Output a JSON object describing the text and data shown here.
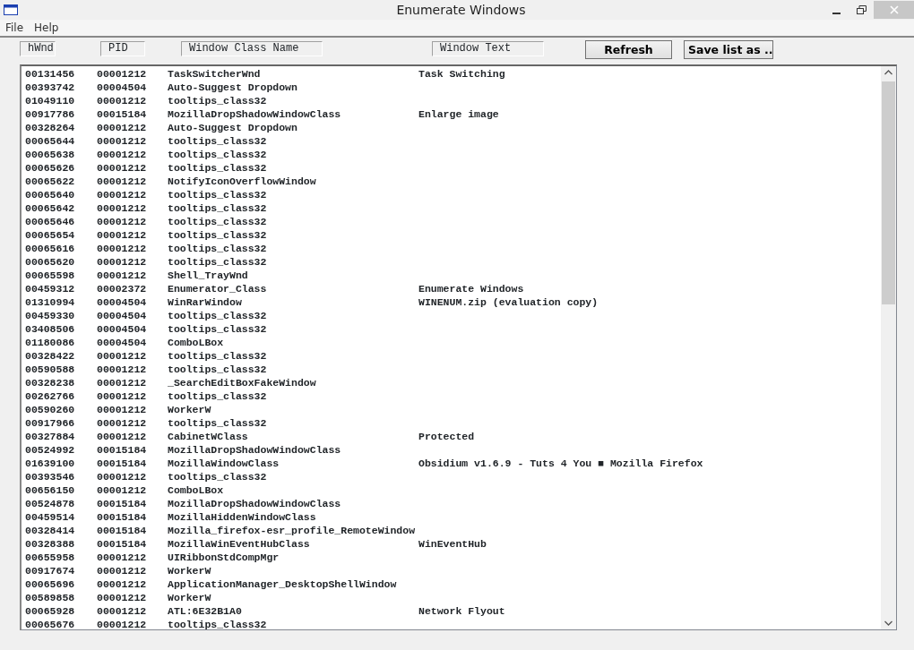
{
  "window": {
    "title": "Enumerate Windows"
  },
  "menu": [
    "File",
    "Help"
  ],
  "headers": [
    "hWnd",
    "PID",
    "Window Class Name",
    "Window Text"
  ],
  "buttons": [
    "Refresh",
    "Save list as .."
  ],
  "rows": [
    {
      "hwnd": "00131456",
      "pid": "00001212",
      "class_name": "TaskSwitcherWnd",
      "text": "Task Switching"
    },
    {
      "hwnd": "00393742",
      "pid": "00004504",
      "class_name": "Auto-Suggest Dropdown"
    },
    {
      "hwnd": "01049110",
      "pid": "00001212",
      "class_name": "tooltips_class32"
    },
    {
      "hwnd": "00917786",
      "pid": "00015184",
      "class_name": "MozillaDropShadowWindowClass",
      "text": "Enlarge image"
    },
    {
      "hwnd": "00328264",
      "pid": "00001212",
      "class_name": "Auto-Suggest Dropdown"
    },
    {
      "hwnd": "00065644",
      "pid": "00001212",
      "class_name": "tooltips_class32"
    },
    {
      "hwnd": "00065638",
      "pid": "00001212",
      "class_name": "tooltips_class32"
    },
    {
      "hwnd": "00065626",
      "pid": "00001212",
      "class_name": "tooltips_class32"
    },
    {
      "hwnd": "00065622",
      "pid": "00001212",
      "class_name": "NotifyIconOverflowWindow"
    },
    {
      "hwnd": "00065640",
      "pid": "00001212",
      "class_name": "tooltips_class32"
    },
    {
      "hwnd": "00065642",
      "pid": "00001212",
      "class_name": "tooltips_class32"
    },
    {
      "hwnd": "00065646",
      "pid": "00001212",
      "class_name": "tooltips_class32"
    },
    {
      "hwnd": "00065654",
      "pid": "00001212",
      "class_name": "tooltips_class32"
    },
    {
      "hwnd": "00065616",
      "pid": "00001212",
      "class_name": "tooltips_class32"
    },
    {
      "hwnd": "00065620",
      "pid": "00001212",
      "class_name": "tooltips_class32"
    },
    {
      "hwnd": "00065598",
      "pid": "00001212",
      "class_name": "Shell_TrayWnd"
    },
    {
      "hwnd": "00459312",
      "pid": "00002372",
      "class_name": "Enumerator_Class",
      "text": "Enumerate Windows"
    },
    {
      "hwnd": "01310994",
      "pid": "00004504",
      "class_name": "WinRarWindow",
      "text": "WINENUM.zip (evaluation copy)"
    },
    {
      "hwnd": "00459330",
      "pid": "00004504",
      "class_name": "tooltips_class32"
    },
    {
      "hwnd": "03408506",
      "pid": "00004504",
      "class_name": "tooltips_class32"
    },
    {
      "hwnd": "01180086",
      "pid": "00004504",
      "class_name": "ComboLBox"
    },
    {
      "hwnd": "00328422",
      "pid": "00001212",
      "class_name": "tooltips_class32"
    },
    {
      "hwnd": "00590588",
      "pid": "00001212",
      "class_name": "tooltips_class32"
    },
    {
      "hwnd": "00328238",
      "pid": "00001212",
      "class_name": "_SearchEditBoxFakeWindow"
    },
    {
      "hwnd": "00262766",
      "pid": "00001212",
      "class_name": "tooltips_class32"
    },
    {
      "hwnd": "00590260",
      "pid": "00001212",
      "class_name": "WorkerW"
    },
    {
      "hwnd": "00917966",
      "pid": "00001212",
      "class_name": "tooltips_class32"
    },
    {
      "hwnd": "00327884",
      "pid": "00001212",
      "class_name": "CabinetWClass",
      "text": "Protected"
    },
    {
      "hwnd": "00524992",
      "pid": "00015184",
      "class_name": "MozillaDropShadowWindowClass"
    },
    {
      "hwnd": "01639100",
      "pid": "00015184",
      "class_name": "MozillaWindowClass",
      "text": "Obsidium v1.6.9 - Tuts 4 You ■ Mozilla Firefox"
    },
    {
      "hwnd": "00393546",
      "pid": "00001212",
      "class_name": "tooltips_class32"
    },
    {
      "hwnd": "00656150",
      "pid": "00001212",
      "class_name": "ComboLBox"
    },
    {
      "hwnd": "00524878",
      "pid": "00015184",
      "class_name": "MozillaDropShadowWindowClass"
    },
    {
      "hwnd": "00459514",
      "pid": "00015184",
      "class_name": "MozillaHiddenWindowClass"
    },
    {
      "hwnd": "00328414",
      "pid": "00015184",
      "class_name": "Mozilla_firefox-esr_profile_RemoteWindow"
    },
    {
      "hwnd": "00328388",
      "pid": "00015184",
      "class_name": "MozillaWinEventHubClass",
      "text": "WinEventHub"
    },
    {
      "hwnd": "00655958",
      "pid": "00001212",
      "class_name": "UIRibbonStdCompMgr"
    },
    {
      "hwnd": "00917674",
      "pid": "00001212",
      "class_name": "WorkerW"
    },
    {
      "hwnd": "00065696",
      "pid": "00001212",
      "class_name": "ApplicationManager_DesktopShellWindow"
    },
    {
      "hwnd": "00589858",
      "pid": "00001212",
      "class_name": "WorkerW"
    },
    {
      "hwnd": "00065928",
      "pid": "00001212",
      "class_name": "ATL:6E32B1A0",
      "text": "Network Flyout"
    },
    {
      "hwnd": "00065676",
      "pid": "00001212",
      "class_name": "tooltips_class32"
    }
  ]
}
